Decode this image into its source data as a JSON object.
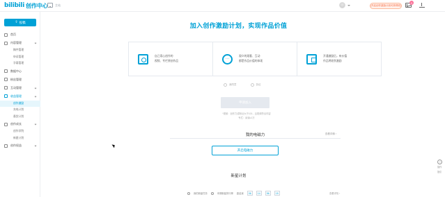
{
  "header": {
    "logo_mark": "bilibili",
    "logo_text": "创作中心",
    "home_label": "主站",
    "upload_pill": "已开启创作激励计划可获得收益",
    "message_badge": "3"
  },
  "sidebar": {
    "submit_label": "投稿",
    "items": [
      {
        "label": "首页",
        "icon": "home-icon",
        "active": false
      },
      {
        "label": "内容管理",
        "icon": "content-icon",
        "active": false,
        "sub": [
          "稿件管理",
          "申诉管理",
          "字幕管理"
        ]
      },
      {
        "label": "数据中心",
        "icon": "data-icon",
        "active": false
      },
      {
        "label": "粉丝管理",
        "icon": "fans-icon",
        "active": false
      },
      {
        "label": "互动管理",
        "icon": "interact-icon",
        "active": false
      },
      {
        "label": "收益管理",
        "icon": "income-icon",
        "active": true,
        "sub": [
          "创作激励",
          "充电计划",
          "悬赏计划"
        ]
      },
      {
        "label": "创作成长",
        "icon": "growth-icon",
        "active": false,
        "sub": [
          "创作学院",
          "新星计划"
        ]
      },
      {
        "label": "创作权益",
        "icon": "rights-icon",
        "active": false
      }
    ]
  },
  "main": {
    "hero_title": "加入创作激励计划，实现作品价值",
    "cards": [
      {
        "icon": "camera-icon",
        "line1": "自己用心创作的",
        "line2": "视频、专栏原创作品"
      },
      {
        "icon": "chat-icon",
        "line1": "观众的观看、互动",
        "line2": "都是作品价值的体现"
      },
      {
        "icon": "wallet-icon",
        "line1": "开通激励后，有价值",
        "line2": "作品将收到激励"
      }
    ],
    "agree_options": [
      "我同意",
      "协议"
    ],
    "join_button": "申请加入",
    "notes_line1": "*视频：创作力或粉丝大于100，且视频符合内容",
    "notes_line2": "专栏：阅读≥1万",
    "charge_section_title": "我的电磁力",
    "charge_section_more": "查看详情 ›",
    "charge_button": "开启电磁力",
    "plan_title": "新星计划",
    "bottom": {
      "option1": "我的新星任务",
      "option2": "本期新星排行榜",
      "countdown_label": "距结束",
      "countdown": [
        "06",
        "14",
        "56",
        "15"
      ],
      "more": "查看详情 ›"
    },
    "help": {
      "glyph": "?",
      "line1": "操作",
      "line2": "指引"
    }
  }
}
